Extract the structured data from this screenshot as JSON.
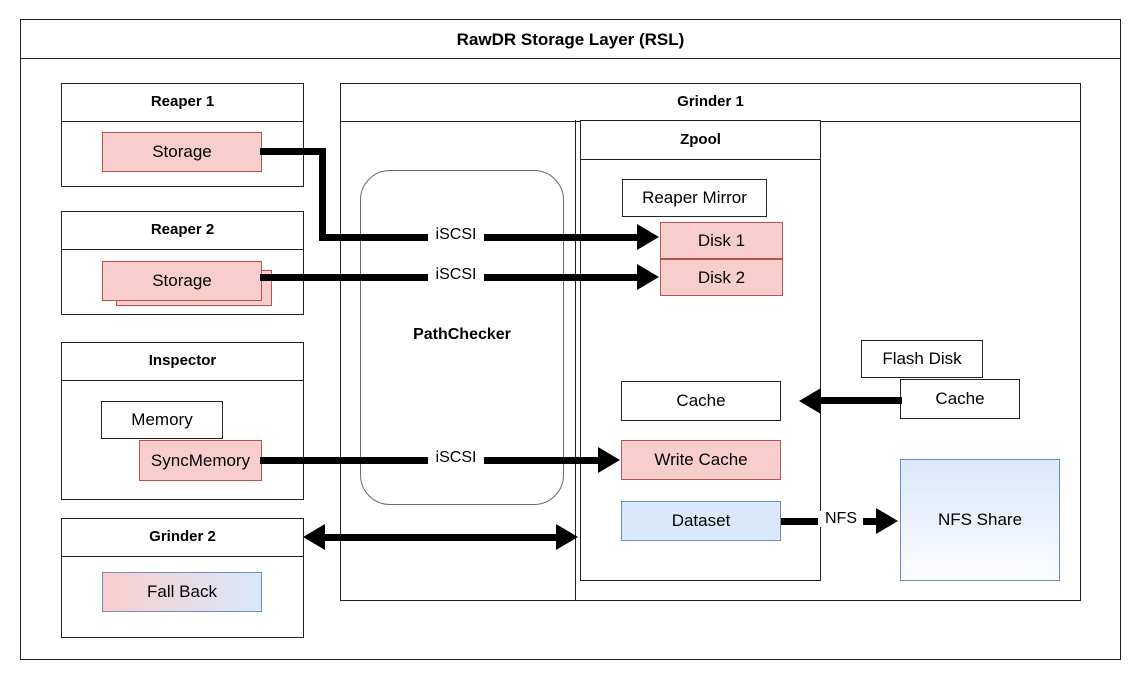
{
  "diagram": {
    "title": "RawDR Storage Layer (RSL)",
    "nodes": {
      "reaper1": {
        "title": "Reaper 1",
        "storage": "Storage"
      },
      "reaper2": {
        "title": "Reaper 2",
        "storage_front": "Storage",
        "storage_back": "Storage"
      },
      "inspector": {
        "title": "Inspector",
        "memory": "Memory",
        "sync_memory": "SyncMemory"
      },
      "grinder2": {
        "title": "Grinder 2",
        "fall_back": "Fall Back"
      },
      "grinder1": {
        "title": "Grinder 1",
        "pathchecker": "PathChecker"
      },
      "zpool": {
        "title": "Zpool",
        "reaper_mirror": "Reaper Mirror",
        "disk1": "Disk 1",
        "disk2": "Disk 2",
        "cache": "Cache",
        "write_cache": "Write Cache",
        "dataset": "Dataset"
      },
      "flash_disk": {
        "title": "Flash Disk",
        "cache": "Cache"
      },
      "nfs_share": {
        "label": "NFS Share"
      }
    },
    "edge_labels": {
      "iscsi_disk1": "iSCSI",
      "iscsi_disk2": "iSCSI",
      "iscsi_write_cache": "iSCSI",
      "nfs": "NFS"
    },
    "colors": {
      "pink_fill": "#f8cecc",
      "pink_stroke": "#b85450",
      "blue_fill": "#dae8fc",
      "blue_stroke": "#6c8ebf",
      "outline": "#232323",
      "edge": "#000000",
      "rounded_stroke": "#6b6b6b",
      "page_background": "#ffffff"
    }
  }
}
